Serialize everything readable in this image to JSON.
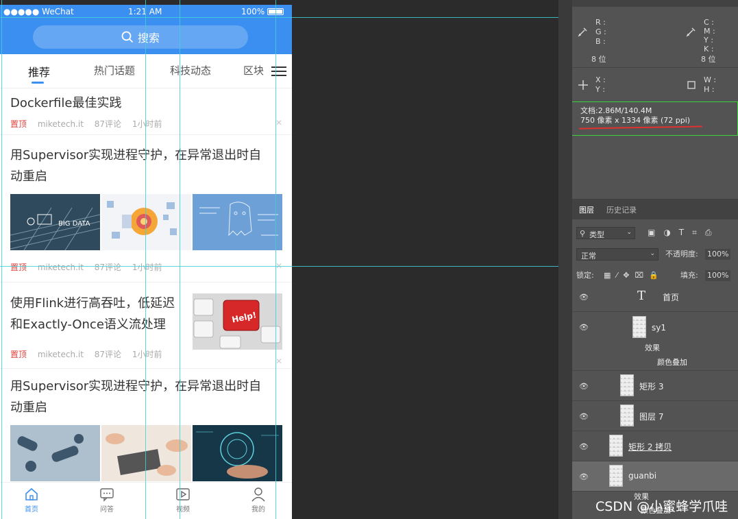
{
  "status_bar": {
    "carrier": "●●●●● WeChat",
    "time": "1:21 AM",
    "battery": "100%"
  },
  "search": {
    "placeholder": "搜索"
  },
  "tabs": [
    {
      "label": "推荐",
      "active": true
    },
    {
      "label": "热门话题"
    },
    {
      "label": "科技动态"
    },
    {
      "label": "区块"
    }
  ],
  "articles": [
    {
      "title": "Dockerfile最佳实践",
      "pin": "置顶",
      "source": "miketech.it",
      "comments": "87评论",
      "time": "1小时前"
    },
    {
      "title_line1": "用Supervisor实现进程守护，在异常退出时自",
      "title_line2": "动重启",
      "pin": "置顶",
      "source": "miketech.it",
      "comments": "87评论",
      "time": "1小时前",
      "image_text": "BIG DATA"
    },
    {
      "title_line1": "使用Flink进行高吞吐，低延迟",
      "title_line2": "和Exactly-Once语义流处理",
      "pin": "置顶",
      "source": "miketech.it",
      "comments": "87评论",
      "time": "1小时前",
      "image_text": "Help!"
    },
    {
      "title_line1": "用Supervisor实现进程守护，在异常退出时自",
      "title_line2": "动重启"
    }
  ],
  "bottom_tabs": [
    {
      "label": "首页",
      "icon": "home-icon",
      "active": true
    },
    {
      "label": "问答",
      "icon": "chat-icon"
    },
    {
      "label": "视频",
      "icon": "video-icon"
    },
    {
      "label": "我的",
      "icon": "user-icon"
    }
  ],
  "ps": {
    "rgb_labels": "R :\nG :\nB :",
    "cmyk_labels": "C :\nM :\nY :\nK :",
    "bits_left": "8 位",
    "bits_right": "8 位",
    "xy_labels": "X :\nY :",
    "wh_labels": "W :\nH :",
    "doc_size": "文档:2.86M/140.4M",
    "doc_dims": "750 像素 x 1334 像素 (72 ppi)",
    "layers_tab": "图层",
    "history_tab": "历史记录",
    "filter_kind": "类型",
    "blend_mode": "正常",
    "opacity_label": "不透明度:",
    "opacity_value": "100%",
    "lock_label": "锁定:",
    "fill_label": "填充:",
    "fill_value": "100%",
    "layers": [
      {
        "name": "首页",
        "kind": "text"
      },
      {
        "name": "sy1",
        "kind": "smart"
      },
      {
        "name": "效果",
        "kind": "effect"
      },
      {
        "name": "颜色叠加",
        "kind": "effect"
      },
      {
        "name": "矩形 3",
        "kind": "smart"
      },
      {
        "name": "图层 7",
        "kind": "smart"
      },
      {
        "name": "矩形 2 拷贝",
        "kind": "smart"
      },
      {
        "name": "guanbi",
        "kind": "smart",
        "selected": true
      },
      {
        "name": "效果",
        "kind": "effect"
      },
      {
        "name": "颜色叠加",
        "kind": "effect"
      }
    ]
  },
  "watermark": "CSDN @小蜜蜂学爪哇",
  "colors": {
    "brand_blue": "#3b8ff0",
    "pin_red": "#e0443f",
    "guide_cyan": "#3fd0d6",
    "highlight_green": "#3bd43b"
  }
}
